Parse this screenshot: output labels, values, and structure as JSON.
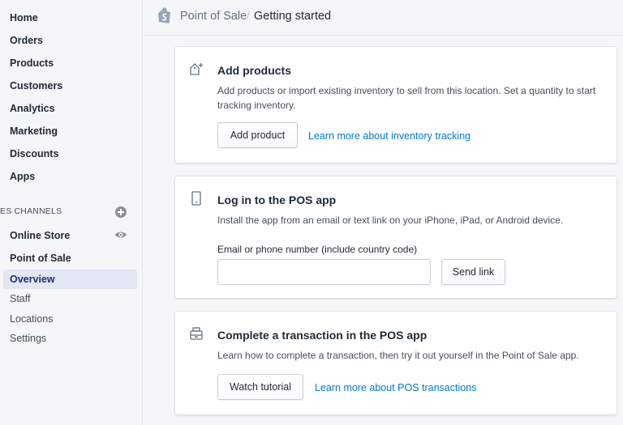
{
  "sidebar": {
    "main_items": [
      {
        "label": "Home"
      },
      {
        "label": "Orders"
      },
      {
        "label": "Products"
      },
      {
        "label": "Customers"
      },
      {
        "label": "Analytics"
      },
      {
        "label": "Marketing"
      },
      {
        "label": "Discounts"
      },
      {
        "label": "Apps"
      }
    ],
    "channels_label": "ES CHANNELS",
    "channels": [
      {
        "label": "Online Store",
        "icon": "eye-icon"
      },
      {
        "label": "Point of Sale"
      }
    ],
    "pos_sub_items": [
      {
        "label": "Overview",
        "active": true
      },
      {
        "label": "Staff"
      },
      {
        "label": "Locations"
      },
      {
        "label": "Settings"
      }
    ]
  },
  "header": {
    "breadcrumb_parent": "Point of Sale",
    "separator": "/",
    "breadcrumb_current": "Getting started"
  },
  "cards": {
    "add_products": {
      "icon": "add-product-icon",
      "title": "Add products",
      "description": "Add products or import existing inventory to sell from this location. Set a quantity to start tracking inventory.",
      "button_label": "Add product",
      "link_label": "Learn more about inventory tracking"
    },
    "login_pos": {
      "icon": "device-icon",
      "title": "Log in to the POS app",
      "description": "Install the app from an email or text link on your iPhone, iPad, or Android device.",
      "field_label": "Email or phone number (include country code)",
      "field_value": "",
      "field_placeholder": "",
      "button_label": "Send link"
    },
    "transaction": {
      "icon": "register-icon",
      "title": "Complete a transaction in the POS app",
      "description": "Learn how to complete a transaction, then try it out yourself in the Point of Sale app.",
      "button_label": "Watch tutorial",
      "link_label": "Learn more about POS transactions"
    }
  },
  "colors": {
    "accent_link": "#007ace",
    "active_nav": "#202e78",
    "active_nav_bg": "#e3e6f3"
  }
}
